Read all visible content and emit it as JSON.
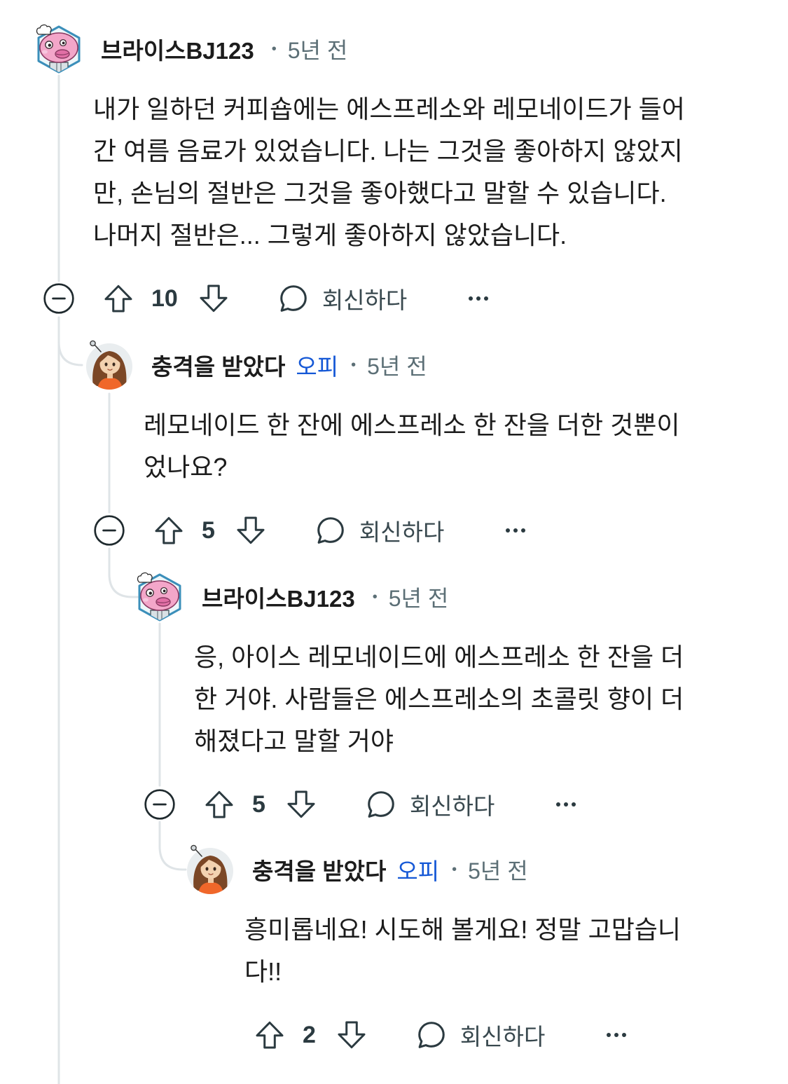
{
  "comments": [
    {
      "avatar": "pink-blob-chef-avatar",
      "username": "브라이스BJ123",
      "separator": "•",
      "time": "5년 전",
      "body_lines": [
        "내가 일하던 커피숍에는 에스프레소와 레모네이드가 들어",
        "간 여름 음료가 있었습니다. 나는 그것을 좋아하지 않았지",
        "만, 손님의 절반은 그것을 좋아했다고 말할 수 있습니다.",
        "나머지 절반은... 그렇게 좋아하지 않았습니다."
      ],
      "score": 10,
      "reply_label": "회신하다"
    },
    {
      "avatar": "girl-avatar",
      "username": "충격을 받았다",
      "op_badge": "오피",
      "separator": "•",
      "time": "5년 전",
      "body_lines": [
        "레모네이드 한 잔에 에스프레소 한 잔을 더한 것뿐이",
        "었나요?"
      ],
      "score": 5,
      "reply_label": "회신하다"
    },
    {
      "avatar": "pink-blob-chef-avatar",
      "username": "브라이스BJ123",
      "separator": "•",
      "time": "5년 전",
      "body_lines": [
        "응, 아이스 레모네이드에 에스프레소 한 잔을 더",
        "한 거야. 사람들은 에스프레소의 초콜릿 향이 더",
        "해졌다고 말할 거야"
      ],
      "score": 5,
      "reply_label": "회신하다"
    },
    {
      "avatar": "girl-avatar",
      "username": "충격을 받았다",
      "op_badge": "오피",
      "separator": "•",
      "time": "5년 전",
      "body_lines": [
        "흥미롭네요! 시도해 볼게요! 정말 고맙습니",
        "다!!"
      ],
      "score": 2,
      "reply_label": "회신하다"
    }
  ],
  "icons": {
    "collapse": "collapse-thread-icon",
    "upvote": "upvote-arrow-icon",
    "downvote": "downvote-arrow-icon",
    "reply": "comment-bubble-icon",
    "more": "more-options-icon"
  },
  "colors": {
    "text": "#1c1c1c",
    "meta": "#5c6f76",
    "op_blue": "#1558d6",
    "thread_line": "#dfe4e7",
    "icon": "#2b3a40"
  }
}
